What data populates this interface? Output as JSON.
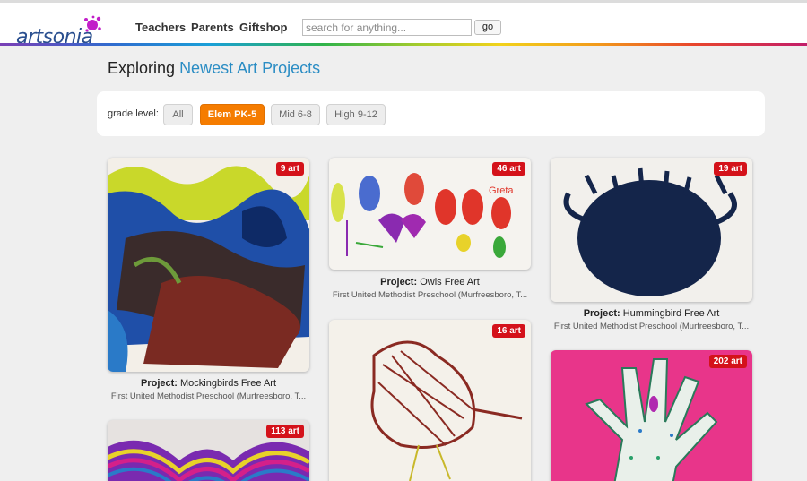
{
  "header": {
    "logo_text": "artsonia",
    "nav": [
      "Teachers",
      "Parents",
      "Giftshop"
    ],
    "search_placeholder": "search for anything...",
    "go_label": "go"
  },
  "page": {
    "heading_prefix": "Exploring",
    "heading_accent": "Newest Art Projects"
  },
  "filters": {
    "label": "grade level:",
    "options": [
      "All",
      "Elem PK-5",
      "Mid 6-8",
      "High 9-12"
    ],
    "selected": "Elem PK-5"
  },
  "projects": [
    {
      "badge": "9 art",
      "title_prefix": "Project:",
      "title": "Mockingbirds Free Art",
      "school": "First United Methodist Preschool (Murfreesboro, T..."
    },
    {
      "badge": "46 art",
      "title_prefix": "Project:",
      "title": "Owls Free Art",
      "school": "First United Methodist Preschool (Murfreesboro, T..."
    },
    {
      "badge": "19 art",
      "title_prefix": "Project:",
      "title": "Hummingbird Free Art",
      "school": "First United Methodist Preschool (Murfreesboro, T..."
    },
    {
      "badge": "113 art"
    },
    {
      "badge": "16 art"
    },
    {
      "badge": "202 art"
    }
  ],
  "colors": {
    "accent_blue": "#2b8dc4",
    "selected_orange": "#f57c00",
    "badge_red": "#d4121a"
  }
}
